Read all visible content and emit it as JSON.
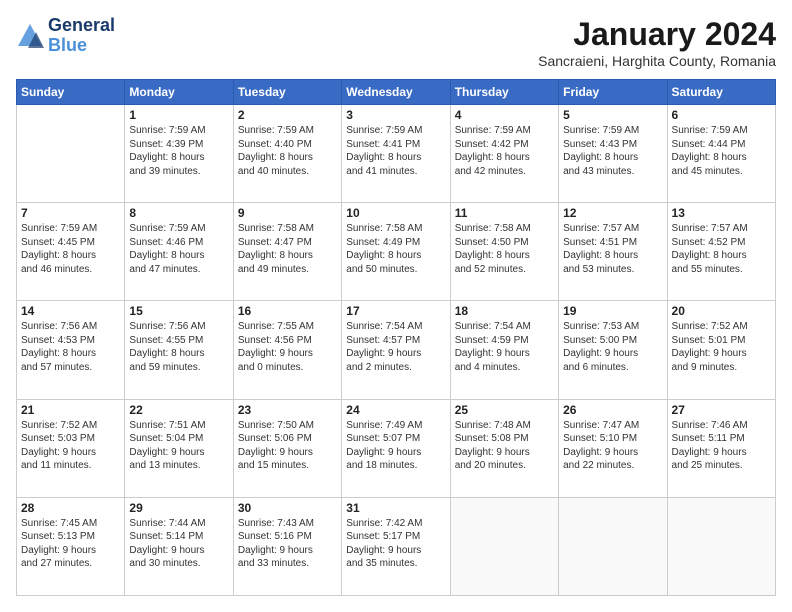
{
  "header": {
    "logo_line1": "General",
    "logo_line2": "Blue",
    "month_title": "January 2024",
    "subtitle": "Sancraieni, Harghita County, Romania"
  },
  "weekdays": [
    "Sunday",
    "Monday",
    "Tuesday",
    "Wednesday",
    "Thursday",
    "Friday",
    "Saturday"
  ],
  "weeks": [
    [
      {
        "day": "",
        "info": ""
      },
      {
        "day": "1",
        "info": "Sunrise: 7:59 AM\nSunset: 4:39 PM\nDaylight: 8 hours\nand 39 minutes."
      },
      {
        "day": "2",
        "info": "Sunrise: 7:59 AM\nSunset: 4:40 PM\nDaylight: 8 hours\nand 40 minutes."
      },
      {
        "day": "3",
        "info": "Sunrise: 7:59 AM\nSunset: 4:41 PM\nDaylight: 8 hours\nand 41 minutes."
      },
      {
        "day": "4",
        "info": "Sunrise: 7:59 AM\nSunset: 4:42 PM\nDaylight: 8 hours\nand 42 minutes."
      },
      {
        "day": "5",
        "info": "Sunrise: 7:59 AM\nSunset: 4:43 PM\nDaylight: 8 hours\nand 43 minutes."
      },
      {
        "day": "6",
        "info": "Sunrise: 7:59 AM\nSunset: 4:44 PM\nDaylight: 8 hours\nand 45 minutes."
      }
    ],
    [
      {
        "day": "7",
        "info": "Sunrise: 7:59 AM\nSunset: 4:45 PM\nDaylight: 8 hours\nand 46 minutes."
      },
      {
        "day": "8",
        "info": "Sunrise: 7:59 AM\nSunset: 4:46 PM\nDaylight: 8 hours\nand 47 minutes."
      },
      {
        "day": "9",
        "info": "Sunrise: 7:58 AM\nSunset: 4:47 PM\nDaylight: 8 hours\nand 49 minutes."
      },
      {
        "day": "10",
        "info": "Sunrise: 7:58 AM\nSunset: 4:49 PM\nDaylight: 8 hours\nand 50 minutes."
      },
      {
        "day": "11",
        "info": "Sunrise: 7:58 AM\nSunset: 4:50 PM\nDaylight: 8 hours\nand 52 minutes."
      },
      {
        "day": "12",
        "info": "Sunrise: 7:57 AM\nSunset: 4:51 PM\nDaylight: 8 hours\nand 53 minutes."
      },
      {
        "day": "13",
        "info": "Sunrise: 7:57 AM\nSunset: 4:52 PM\nDaylight: 8 hours\nand 55 minutes."
      }
    ],
    [
      {
        "day": "14",
        "info": "Sunrise: 7:56 AM\nSunset: 4:53 PM\nDaylight: 8 hours\nand 57 minutes."
      },
      {
        "day": "15",
        "info": "Sunrise: 7:56 AM\nSunset: 4:55 PM\nDaylight: 8 hours\nand 59 minutes."
      },
      {
        "day": "16",
        "info": "Sunrise: 7:55 AM\nSunset: 4:56 PM\nDaylight: 9 hours\nand 0 minutes."
      },
      {
        "day": "17",
        "info": "Sunrise: 7:54 AM\nSunset: 4:57 PM\nDaylight: 9 hours\nand 2 minutes."
      },
      {
        "day": "18",
        "info": "Sunrise: 7:54 AM\nSunset: 4:59 PM\nDaylight: 9 hours\nand 4 minutes."
      },
      {
        "day": "19",
        "info": "Sunrise: 7:53 AM\nSunset: 5:00 PM\nDaylight: 9 hours\nand 6 minutes."
      },
      {
        "day": "20",
        "info": "Sunrise: 7:52 AM\nSunset: 5:01 PM\nDaylight: 9 hours\nand 9 minutes."
      }
    ],
    [
      {
        "day": "21",
        "info": "Sunrise: 7:52 AM\nSunset: 5:03 PM\nDaylight: 9 hours\nand 11 minutes."
      },
      {
        "day": "22",
        "info": "Sunrise: 7:51 AM\nSunset: 5:04 PM\nDaylight: 9 hours\nand 13 minutes."
      },
      {
        "day": "23",
        "info": "Sunrise: 7:50 AM\nSunset: 5:06 PM\nDaylight: 9 hours\nand 15 minutes."
      },
      {
        "day": "24",
        "info": "Sunrise: 7:49 AM\nSunset: 5:07 PM\nDaylight: 9 hours\nand 18 minutes."
      },
      {
        "day": "25",
        "info": "Sunrise: 7:48 AM\nSunset: 5:08 PM\nDaylight: 9 hours\nand 20 minutes."
      },
      {
        "day": "26",
        "info": "Sunrise: 7:47 AM\nSunset: 5:10 PM\nDaylight: 9 hours\nand 22 minutes."
      },
      {
        "day": "27",
        "info": "Sunrise: 7:46 AM\nSunset: 5:11 PM\nDaylight: 9 hours\nand 25 minutes."
      }
    ],
    [
      {
        "day": "28",
        "info": "Sunrise: 7:45 AM\nSunset: 5:13 PM\nDaylight: 9 hours\nand 27 minutes."
      },
      {
        "day": "29",
        "info": "Sunrise: 7:44 AM\nSunset: 5:14 PM\nDaylight: 9 hours\nand 30 minutes."
      },
      {
        "day": "30",
        "info": "Sunrise: 7:43 AM\nSunset: 5:16 PM\nDaylight: 9 hours\nand 33 minutes."
      },
      {
        "day": "31",
        "info": "Sunrise: 7:42 AM\nSunset: 5:17 PM\nDaylight: 9 hours\nand 35 minutes."
      },
      {
        "day": "",
        "info": ""
      },
      {
        "day": "",
        "info": ""
      },
      {
        "day": "",
        "info": ""
      }
    ]
  ]
}
